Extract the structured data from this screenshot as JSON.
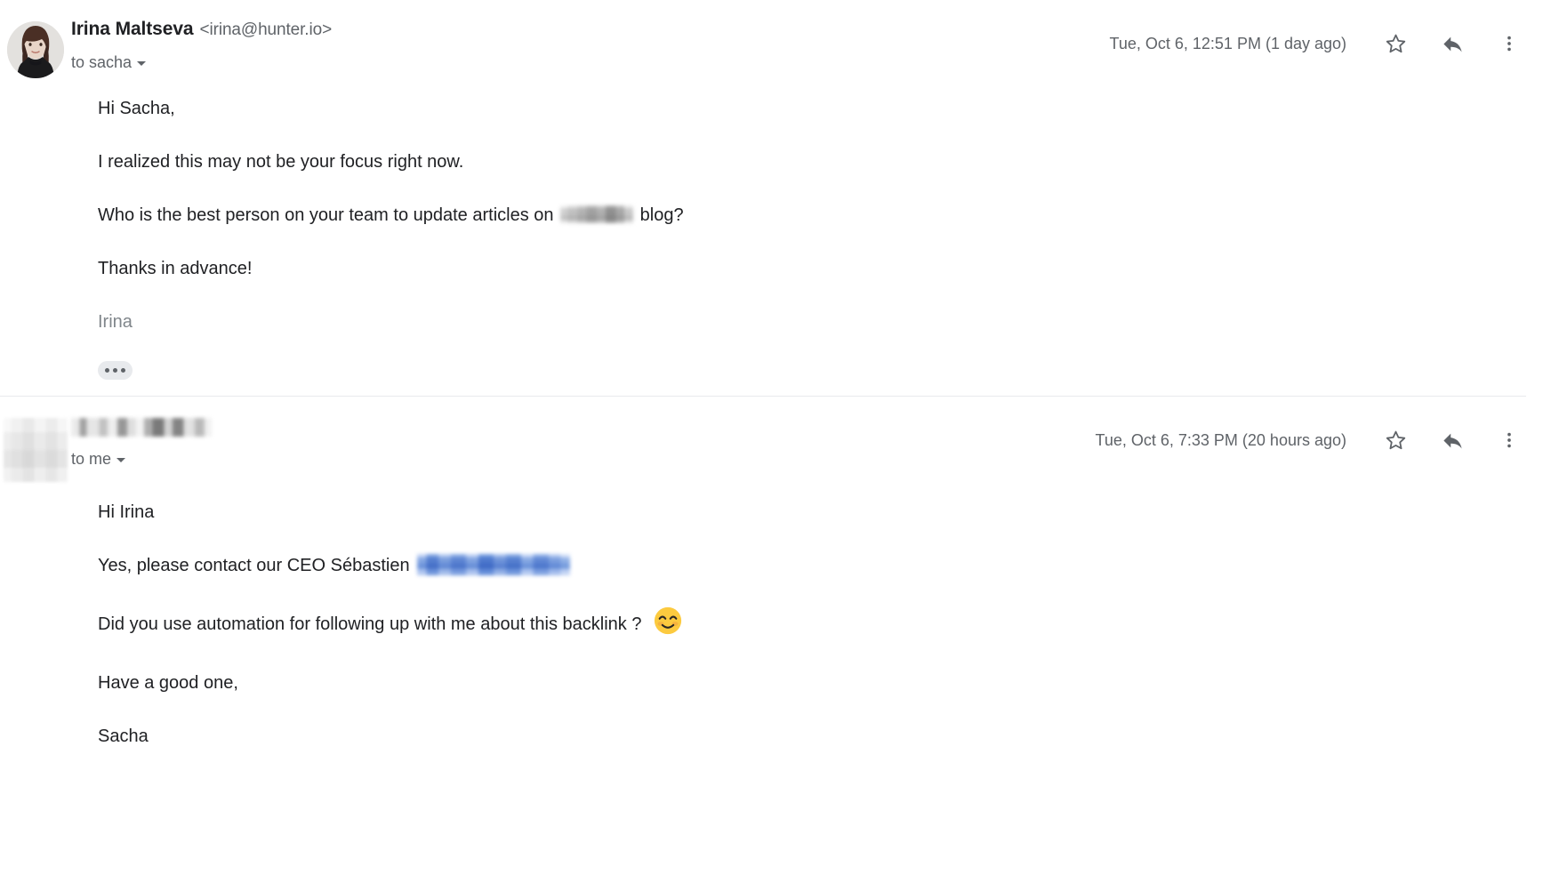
{
  "thread": {
    "messages": [
      {
        "sender_name": "Irina Maltseva",
        "sender_email": "<irina@hunter.io>",
        "sender_redacted": false,
        "avatar_type": "photo",
        "recipient": "to sacha",
        "timestamp": "Tue, Oct 6, 12:51 PM (1 day ago)",
        "paragraphs": [
          {
            "text": "Hi Sacha,",
            "style": "normal"
          },
          {
            "text": "I realized this may not be your focus right now.",
            "style": "normal"
          },
          {
            "before": "Who is the best person on your team to update articles on",
            "redaction": "gray",
            "after": "blog?",
            "style": "normal"
          },
          {
            "text": "Thanks in advance!",
            "style": "normal"
          },
          {
            "text": "Irina",
            "style": "quoted"
          }
        ],
        "has_expander": true,
        "actions": {
          "star": "star-icon",
          "reply": "reply-icon",
          "more": "more-vert-icon"
        }
      },
      {
        "sender_name": "",
        "sender_email": "",
        "sender_redacted": true,
        "avatar_type": "redacted",
        "recipient": "to me",
        "timestamp": "Tue, Oct 6, 7:33 PM (20 hours ago)",
        "paragraphs": [
          {
            "text": "Hi Irina",
            "style": "normal"
          },
          {
            "before": "Yes, please contact our CEO Sébastien",
            "redaction": "blue",
            "after": "",
            "style": "normal"
          },
          {
            "before": "Did you use automation for following up with me about this backlink ?",
            "emoji": "😊",
            "after": "",
            "style": "normal"
          },
          {
            "text": "Have a good one,",
            "style": "normal"
          },
          {
            "text": "Sacha",
            "style": "normal"
          }
        ],
        "has_expander": false,
        "actions": {
          "star": "star-icon",
          "reply": "reply-icon",
          "more": "more-vert-icon"
        }
      }
    ]
  },
  "colors": {
    "text_primary": "#202124",
    "text_secondary": "#5f6368",
    "quoted_text": "#80868b",
    "divider": "#e8eaed",
    "redaction_blue": "#7ea5e1",
    "emoji_yellow": "#f7ca3d"
  }
}
